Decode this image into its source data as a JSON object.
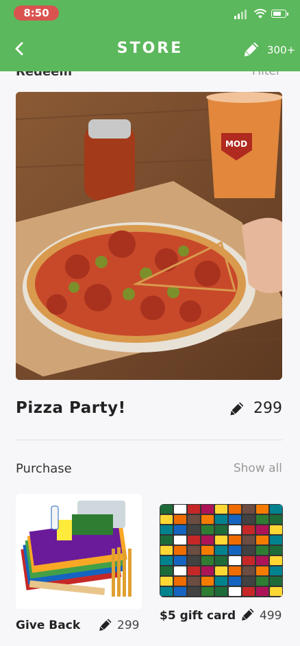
{
  "status_bar": {
    "time": "8:50"
  },
  "header": {
    "title": "STORE",
    "points": "300+"
  },
  "partial_row": {
    "left": "Redeem",
    "right": "Filter"
  },
  "featured": {
    "title": "Pizza Party!",
    "cost": "299",
    "image_text": "MOD"
  },
  "purchase": {
    "section_title": "Purchase",
    "show_all": "Show all",
    "items": [
      {
        "name": "Give Back",
        "cost": "299"
      },
      {
        "name": "$5 gift card",
        "cost": "499"
      }
    ]
  },
  "colors": {
    "header_green": "#5cb85c",
    "time_pill_red": "#d9534f"
  },
  "icons": {
    "back": "chevron-left-icon",
    "points": "pencil-icon"
  }
}
